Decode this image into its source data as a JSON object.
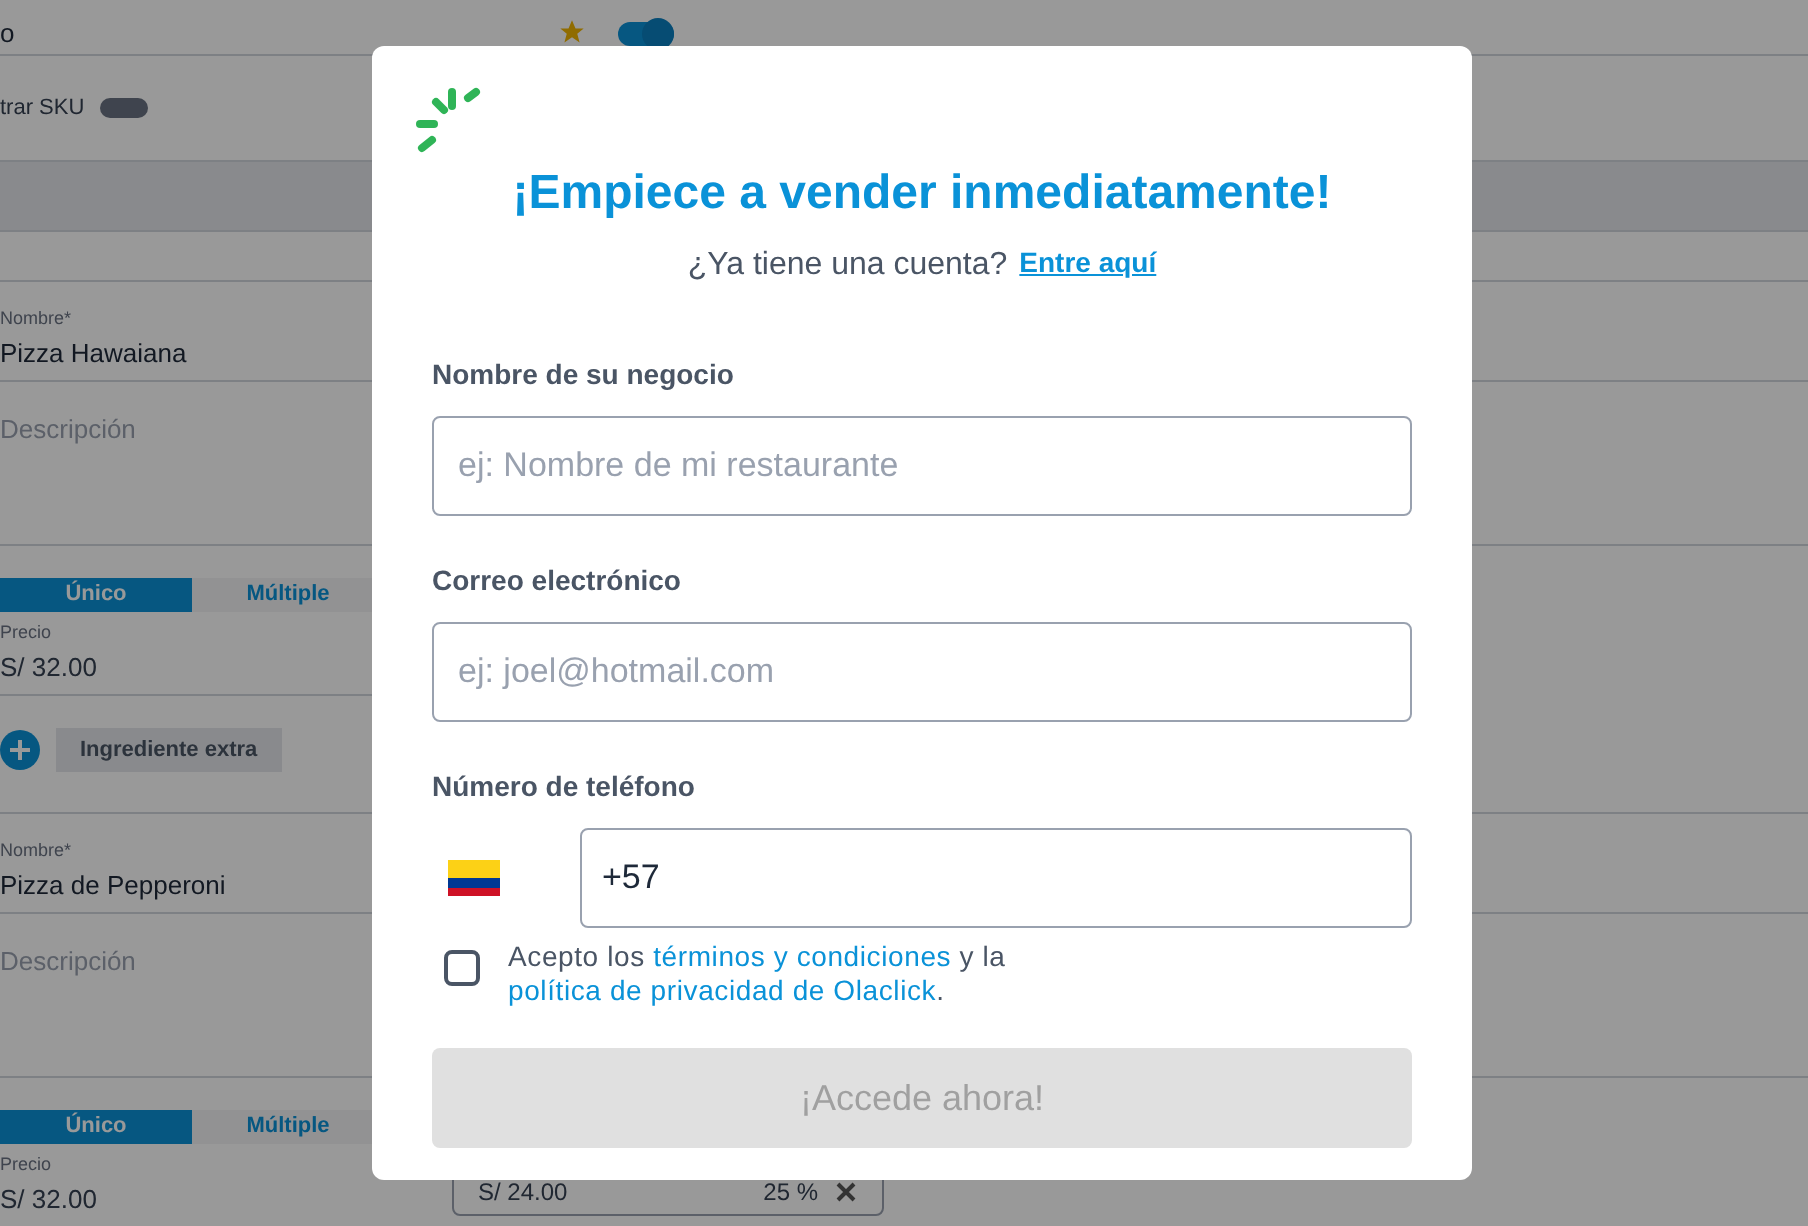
{
  "background": {
    "top_value": "o",
    "top_toggle_on": true,
    "sku_label": "trar SKU",
    "sku_toggle_on": false,
    "products": [
      {
        "name_label": "Nombre*",
        "name": "Pizza Hawaiana",
        "description_placeholder": "Descripción",
        "tabs": [
          {
            "label": "Único",
            "selected": true
          },
          {
            "label": "Múltiple",
            "selected": false
          }
        ],
        "price_label": "Precio",
        "price": "S/ 32.00",
        "extras": [
          "Ingrediente extra"
        ]
      },
      {
        "name_label": "Nombre*",
        "name": "Pizza de Pepperoni",
        "description_placeholder": "Descripción",
        "tabs": [
          {
            "label": "Único",
            "selected": true
          },
          {
            "label": "Múltiple",
            "selected": false
          }
        ],
        "price_label": "Precio",
        "price": "S/ 32.00",
        "discount_price": "S/ 24.00",
        "discount": "25 %"
      }
    ]
  },
  "modal": {
    "title": "¡Empiece a vender inmediatamente!",
    "subtitle": "¿Ya tiene una cuenta?",
    "login_link": "Entre aquí",
    "fields": [
      {
        "label": "Nombre de su negocio",
        "placeholder": "ej: Nombre de mi restaurante"
      },
      {
        "label": "Correo electrónico",
        "placeholder": "ej: joel@hotmail.com"
      }
    ],
    "phone": {
      "label": "Número de teléfono",
      "value": "+57"
    },
    "terms": {
      "checked": false,
      "prefix": "Acepto los",
      "terms_link": "términos y condiciones",
      "middle": "y la",
      "privacy_link": "política de privacidad de Olaclick",
      "suffix": "."
    },
    "submit": {
      "label": "¡Accede ahora!",
      "disabled": true
    }
  }
}
